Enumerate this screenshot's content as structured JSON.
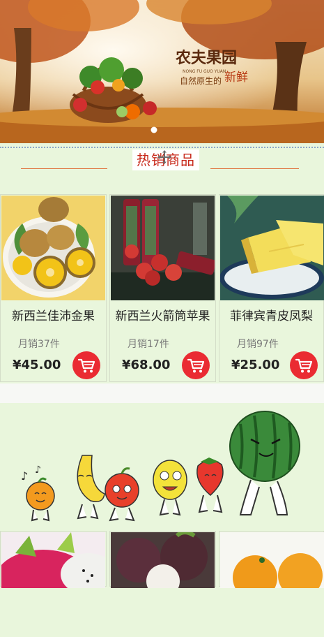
{
  "banner": {
    "brand": "农夫果园",
    "sub_pinyin": "NONG FU GUO YUAN",
    "slogan_a": "自然原生的",
    "slogan_b": "新鲜"
  },
  "section": {
    "title": "热销商品"
  },
  "products": [
    {
      "name": "新西兰佳沛金果",
      "sold": "月销37件",
      "price": "¥45.00"
    },
    {
      "name": "新西兰火箭筒苹果",
      "sold": "月销17件",
      "price": "¥68.00"
    },
    {
      "name": "菲律宾青皮凤梨",
      "sold": "月销97件",
      "price": "¥25.00"
    }
  ],
  "icons": {
    "cart": "shopping-cart-icon",
    "move": "move-arrows-icon"
  },
  "colors": {
    "accent": "#ea2b32",
    "title": "#c82b1d",
    "background": "#e9f6dc"
  }
}
